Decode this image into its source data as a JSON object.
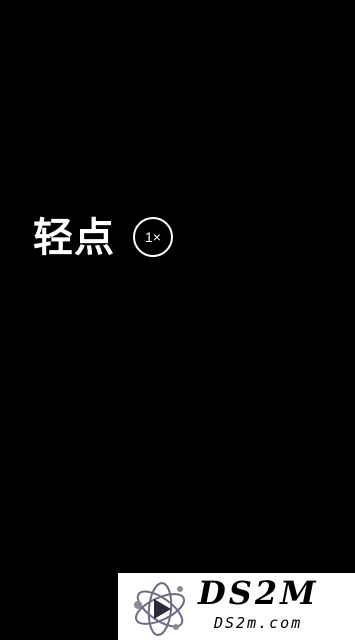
{
  "main": {
    "hint_label": "轻点",
    "zoom_label": "1×"
  },
  "watermark": {
    "title": "DS2M",
    "url": "DS2m.com",
    "logo_icon": "atom-play-logo-icon"
  },
  "colors": {
    "background": "#000000",
    "foreground": "#ffffff",
    "watermark_bg": "#ffffff",
    "watermark_text": "#000000"
  }
}
